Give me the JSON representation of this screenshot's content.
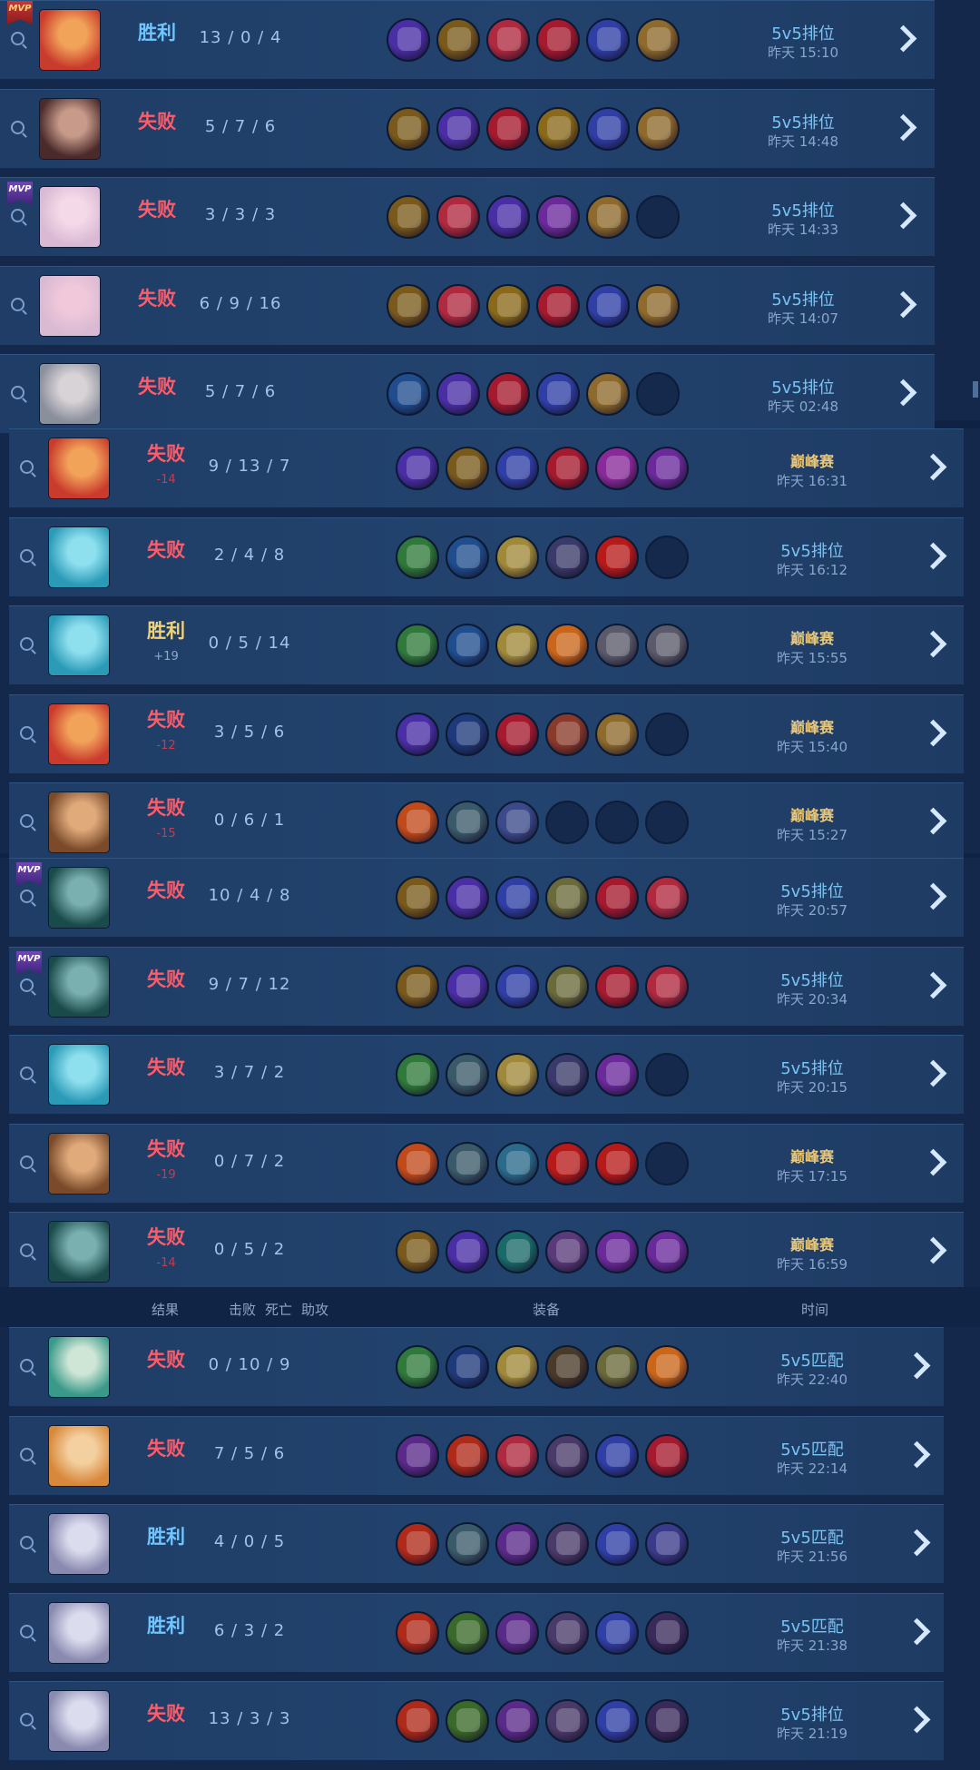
{
  "icons": {
    "replay": "replay-icon",
    "mvp": "mvp-badge",
    "arrow": "chevron-right-icon"
  },
  "colors": {
    "lose": "#ff5b69",
    "win": "#6fc5ff",
    "peak_mode": "#e8c77a",
    "ranked_mode": "#78c4f4"
  },
  "header": {
    "result": "结果",
    "kda_k": "击败",
    "kda_d": "死亡",
    "kda_a": "助攻",
    "items": "装备",
    "time": "时间"
  },
  "sections": [
    {
      "rows": [
        {
          "mvp": "MVP",
          "mvp_color": "red",
          "hero": [
            "#c93b2c",
            "#f2a35a"
          ],
          "result": "胜利",
          "type": "win",
          "delta": "",
          "kda": "13 / 0 / 4",
          "items": [
            "#4a2ea5",
            "#7a5a1c",
            "#b02a3f",
            "#a51a2e",
            "#2f3fa6",
            "#8e6a2c"
          ],
          "mode": "5v5排位",
          "peak": false,
          "time": "昨天 15:10"
        },
        {
          "mvp": "",
          "hero": [
            "#4a2a2a",
            "#c79a8a"
          ],
          "result": "失败",
          "type": "lose",
          "delta": "",
          "kda": "5 / 7 / 6",
          "items": [
            "#7a5a1c",
            "#4a2ea5",
            "#a51a2e",
            "#8a6a1a",
            "#2f3fa6",
            "#8e6a2c"
          ],
          "mode": "5v5排位",
          "peak": false,
          "time": "昨天 14:48"
        },
        {
          "mvp": "MVP",
          "mvp_color": "purple",
          "hero": [
            "#d9b9d3",
            "#f4d9e8"
          ],
          "result": "失败",
          "type": "lose",
          "delta": "",
          "kda": "3 / 3 / 3",
          "items": [
            "#7a5a1c",
            "#b02a3f",
            "#4a2ea5",
            "#6a2a9a",
            "#8e6a2c",
            "empty"
          ],
          "mode": "5v5排位",
          "peak": false,
          "time": "昨天 14:33"
        },
        {
          "mvp": "",
          "hero": [
            "#d9b9d3",
            "#f0c8da"
          ],
          "result": "失败",
          "type": "lose",
          "delta": "",
          "kda": "6 / 9 / 16",
          "items": [
            "#7a5a1c",
            "#b02a3f",
            "#8a6a1a",
            "#a51a2e",
            "#2f3fa6",
            "#8e6a2c"
          ],
          "mode": "5v5排位",
          "peak": false,
          "time": "昨天 14:07"
        },
        {
          "mvp": "",
          "hero": [
            "#8a8f9c",
            "#d8d3d6"
          ],
          "result": "失败",
          "type": "lose",
          "delta": "",
          "kda": "5 / 7 / 6",
          "items": [
            "#1f4d8e",
            "#4a2ea5",
            "#a51a2e",
            "#2f3fa6",
            "#8e6a2c",
            "empty"
          ],
          "mode": "5v5排位",
          "peak": false,
          "time": "昨天 02:48"
        }
      ]
    },
    {
      "rows": [
        {
          "mvp": "",
          "hero": [
            "#c93b2c",
            "#f2a35a"
          ],
          "result": "失败",
          "type": "lose",
          "delta": "-14",
          "kda": "9 / 13 / 7",
          "items": [
            "#4a2ea5",
            "#7a5a1c",
            "#2f3fa6",
            "#a51a2e",
            "#8a2a9a",
            "#6a2a9a"
          ],
          "mode": "巅峰赛",
          "peak": true,
          "time": "昨天 16:31"
        },
        {
          "mvp": "",
          "hero": [
            "#2a9ab7",
            "#8fe0ef"
          ],
          "result": "失败",
          "type": "lose",
          "delta": "",
          "kda": "2 / 4 / 8",
          "items": [
            "#2f7a3a",
            "#1f4d8e",
            "#a08a3a",
            "#3a3a6a",
            "#b81a1a",
            "empty"
          ],
          "mode": "5v5排位",
          "peak": false,
          "time": "昨天 16:12"
        },
        {
          "mvp": "",
          "hero": [
            "#2a9ab7",
            "#8fe0ef"
          ],
          "result": "胜利",
          "type": "gold",
          "delta": "+19",
          "kda": "0 / 5 / 14",
          "items": [
            "#2f7a3a",
            "#1f4d8e",
            "#a08a3a",
            "#c9661a",
            "#5a5a6a",
            "#5a5a6a"
          ],
          "mode": "巅峰赛",
          "peak": true,
          "time": "昨天 15:55"
        },
        {
          "mvp": "",
          "hero": [
            "#c93b2c",
            "#f2a35a"
          ],
          "result": "失败",
          "type": "lose",
          "delta": "-12",
          "kda": "3 / 5 / 6",
          "items": [
            "#4a2ea5",
            "#1f3a7a",
            "#a51a2e",
            "#8a3a2a",
            "#8e6a2c",
            "empty"
          ],
          "mode": "巅峰赛",
          "peak": true,
          "time": "昨天 15:40"
        },
        {
          "mvp": "",
          "hero": [
            "#7a4a2a",
            "#e0aa7a"
          ],
          "result": "失败",
          "type": "lose",
          "delta": "-15",
          "kda": "0 / 6 / 1",
          "items": [
            "#c04a1a",
            "#3a5a6a",
            "#3a4a8a",
            "empty",
            "empty",
            "empty"
          ],
          "mode": "巅峰赛",
          "peak": true,
          "time": "昨天 15:27"
        }
      ]
    },
    {
      "rows": [
        {
          "mvp": "MVP",
          "mvp_color": "purple",
          "hero": [
            "#1a4a4a",
            "#7ab0b0"
          ],
          "result": "失败",
          "type": "lose",
          "delta": "",
          "kda": "10 / 4 / 8",
          "items": [
            "#7a5a1c",
            "#4a2ea5",
            "#2f3fa6",
            "#6a6a3a",
            "#a51a2e",
            "#b02a3f"
          ],
          "mode": "5v5排位",
          "peak": false,
          "time": "昨天 20:57"
        },
        {
          "mvp": "MVP",
          "mvp_color": "purple",
          "hero": [
            "#1a4a4a",
            "#7ab0b0"
          ],
          "result": "失败",
          "type": "lose",
          "delta": "",
          "kda": "9 / 7 / 12",
          "items": [
            "#7a5a1c",
            "#4a2ea5",
            "#2f3fa6",
            "#6a6a3a",
            "#a51a2e",
            "#b02a3f"
          ],
          "mode": "5v5排位",
          "peak": false,
          "time": "昨天 20:34"
        },
        {
          "mvp": "",
          "hero": [
            "#2a9ab7",
            "#8fe0ef"
          ],
          "result": "失败",
          "type": "lose",
          "delta": "",
          "kda": "3 / 7 / 2",
          "items": [
            "#2f7a3a",
            "#3a5a6a",
            "#a08a3a",
            "#3a3a6a",
            "#6a2a9a",
            "empty"
          ],
          "mode": "5v5排位",
          "peak": false,
          "time": "昨天 20:15"
        },
        {
          "mvp": "",
          "hero": [
            "#7a4a2a",
            "#e0aa7a"
          ],
          "result": "失败",
          "type": "lose",
          "delta": "-19",
          "kda": "0 / 7 / 2",
          "items": [
            "#c04a1a",
            "#3a5a6a",
            "#2a6a8a",
            "#b81a1a",
            "#b81a1a",
            "empty"
          ],
          "mode": "巅峰赛",
          "peak": true,
          "time": "昨天 17:15"
        },
        {
          "mvp": "",
          "hero": [
            "#1a4a4a",
            "#7ab0b0"
          ],
          "result": "失败",
          "type": "lose",
          "delta": "-14",
          "kda": "0 / 5 / 2",
          "items": [
            "#7a5a1c",
            "#4a2ea5",
            "#1a6a6a",
            "#5a3a7a",
            "#6a2a9a",
            "#6a2a9a"
          ],
          "mode": "巅峰赛",
          "peak": true,
          "time": "昨天 16:59"
        }
      ]
    },
    {
      "rows": [
        {
          "mvp": "",
          "hero": [
            "#3a9a8a",
            "#cfe6d6"
          ],
          "result": "失败",
          "type": "lose",
          "delta": "",
          "kda": "0 / 10 / 9",
          "items": [
            "#2f7a3a",
            "#1f3a7a",
            "#a08a3a",
            "#4a3a2a",
            "#6a6a3a",
            "#c9661a"
          ],
          "mode": "5v5匹配",
          "peak": false,
          "time": "昨天 22:40"
        },
        {
          "mvp": "",
          "hero": [
            "#d8883a",
            "#f4d0a0"
          ],
          "result": "失败",
          "type": "lose",
          "delta": "",
          "kda": "7 / 5 / 6",
          "items": [
            "#5a2a8a",
            "#b02a1a",
            "#b02a3f",
            "#4a3a6a",
            "#2f3fa6",
            "#a51a2e"
          ],
          "mode": "5v5匹配",
          "peak": false,
          "time": "昨天 22:14"
        },
        {
          "mvp": "",
          "hero": [
            "#8a8ab0",
            "#dcdcef"
          ],
          "result": "胜利",
          "type": "win",
          "delta": "",
          "kda": "4 / 0 / 5",
          "items": [
            "#b02a1a",
            "#3a5a6a",
            "#5a2a8a",
            "#4a3a6a",
            "#2f3fa6",
            "#3a3a8a"
          ],
          "mode": "5v5匹配",
          "peak": false,
          "time": "昨天 21:56"
        },
        {
          "mvp": "",
          "hero": [
            "#8a8ab0",
            "#dcdcef"
          ],
          "result": "胜利",
          "type": "win",
          "delta": "",
          "kda": "6 / 3 / 2",
          "items": [
            "#b02a1a",
            "#3a6a2a",
            "#5a2a8a",
            "#4a3a6a",
            "#2f3fa6",
            "#3a2a5a"
          ],
          "mode": "5v5匹配",
          "peak": false,
          "time": "昨天 21:38"
        },
        {
          "mvp": "",
          "hero": [
            "#8a8ab0",
            "#dcdcef"
          ],
          "result": "失败",
          "type": "lose",
          "delta": "",
          "kda": "13 / 3 / 3",
          "items": [
            "#b02a1a",
            "#3a6a2a",
            "#5a2a8a",
            "#4a3a6a",
            "#2f3fa6",
            "#3a2a5a"
          ],
          "mode": "5v5排位",
          "peak": false,
          "time": "昨天 21:19"
        }
      ]
    }
  ]
}
